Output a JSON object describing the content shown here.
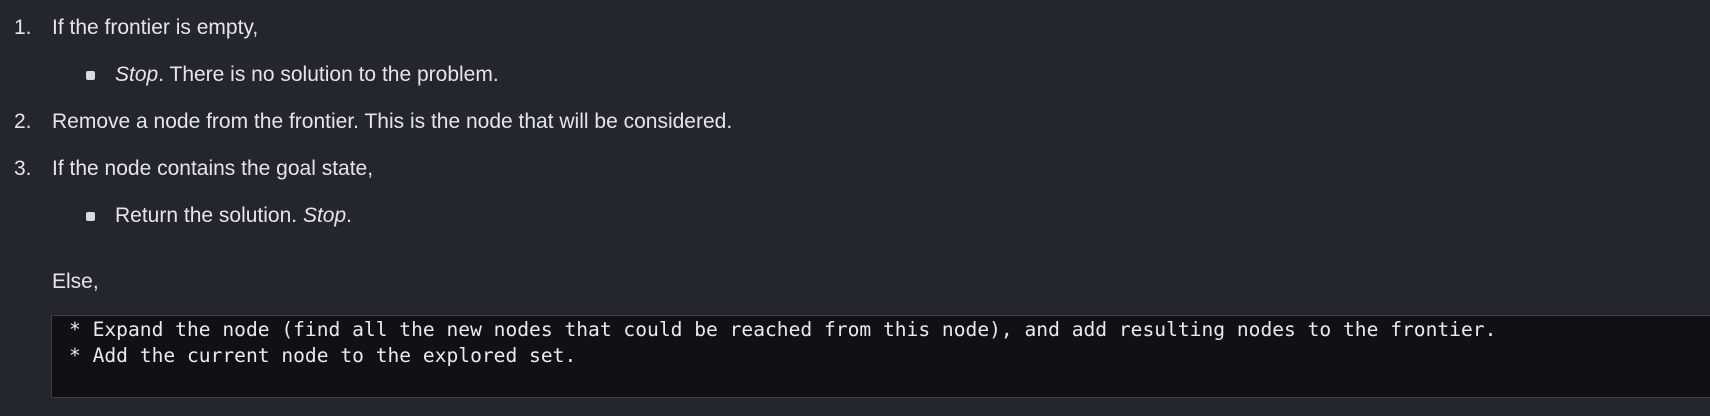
{
  "list": {
    "item1": {
      "number": "1.",
      "text": "If the frontier is empty,"
    },
    "item1_sub": {
      "emphasis": "Stop",
      "text": ". There is no solution to the problem."
    },
    "item2": {
      "number": "2.",
      "text": "Remove a node from the frontier. This is the node that will be considered."
    },
    "item3": {
      "number": "3.",
      "text": "If the node contains the goal state,"
    },
    "item3_sub": {
      "text": "Return the solution. ",
      "emphasis": "Stop",
      "suffix": "."
    }
  },
  "else_text": "Else,",
  "code_block": {
    "line1": "* Expand the node (find all the new nodes that could be reached from this node), and add resulting nodes to the frontier.",
    "line2": "* Add the current node to the explored set."
  }
}
